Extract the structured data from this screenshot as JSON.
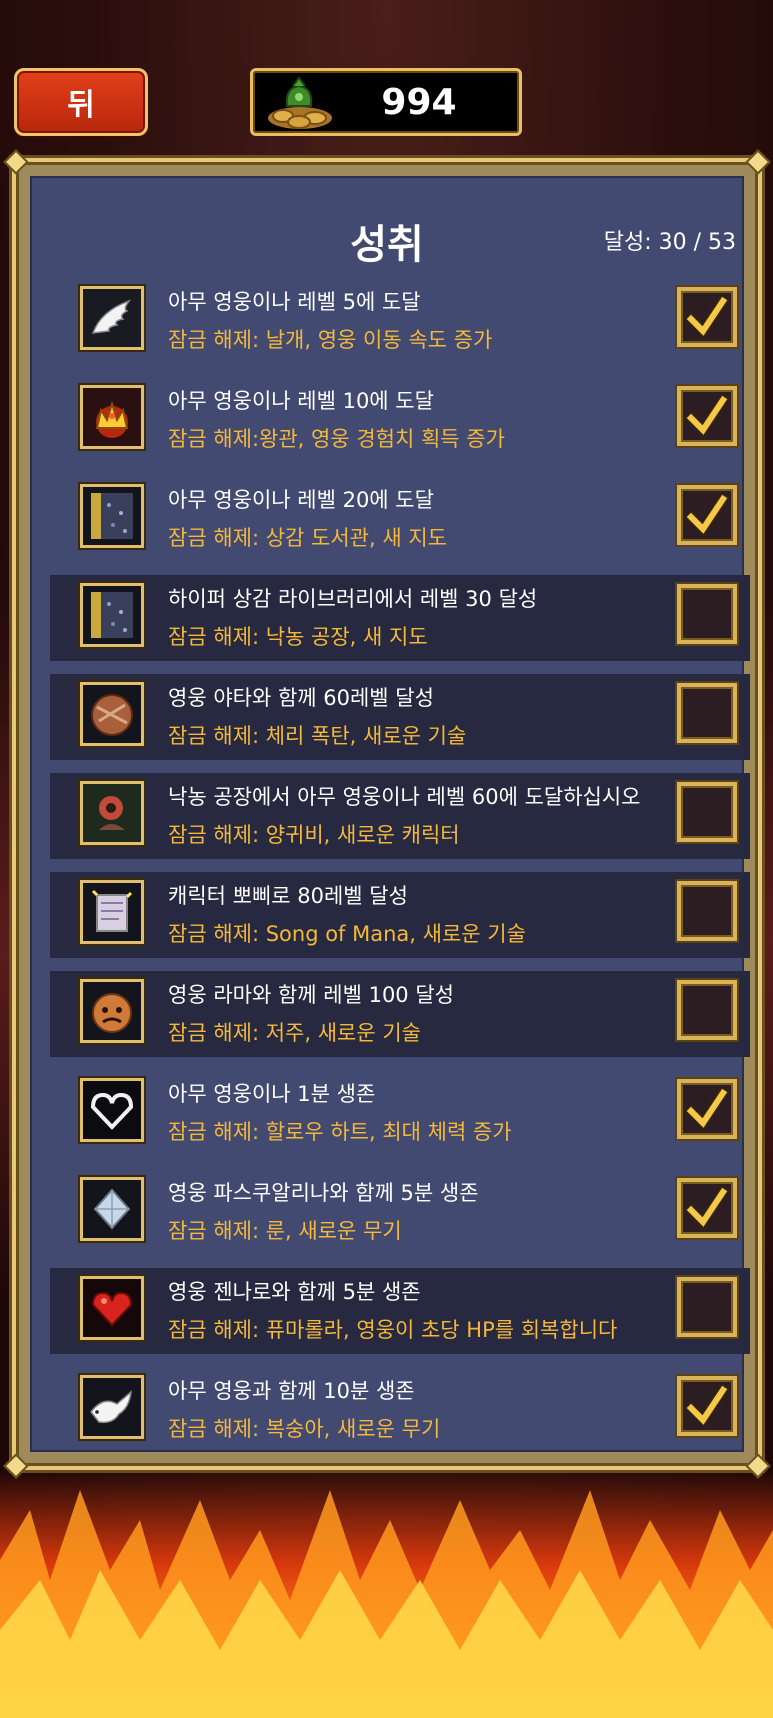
{
  "header": {
    "back_label": "뒤",
    "coins": "994"
  },
  "panel": {
    "title": "성취",
    "progress": "달성: 30 / 53"
  },
  "achievements": [
    {
      "desc": "아무 영웅이나 레벨 5에 도달",
      "reward": "잠금 해제: 날개, 영웅 이동 속도 증가",
      "completed": true,
      "icon": "wing-icon"
    },
    {
      "desc": "아무 영웅이나 레벨 10에 도달",
      "reward": "잠금 해제:왕관, 영웅 경험치 획득 증가",
      "completed": true,
      "icon": "crown-icon"
    },
    {
      "desc": "아무 영웅이나 레벨 20에 도달",
      "reward": "잠금 해제: 상감 도서관, 새 지도",
      "completed": true,
      "icon": "library-map-icon"
    },
    {
      "desc": "하이퍼 상감 라이브러리에서 레벨 30 달성",
      "reward": "잠금 해제: 낙농 공장, 새 지도",
      "completed": false,
      "icon": "library-map-icon"
    },
    {
      "desc": "영웅 야타와 함께 60레벨 달성",
      "reward": "잠금 해제: 체리 폭탄, 새로운 기술",
      "completed": false,
      "icon": "cherry-bomb-icon"
    },
    {
      "desc": "낙농 공장에서 아무 영웅이나 레벨 60에 도달하십시오",
      "reward": "잠금 해제: 양귀비, 새로운 캐릭터",
      "completed": false,
      "icon": "poppy-character-icon"
    },
    {
      "desc": "캐릭터 뽀삐로 80레벨 달성",
      "reward": "잠금 해제: Song of Mana, 새로운 기술",
      "completed": false,
      "icon": "scroll-icon"
    },
    {
      "desc": "영웅 라마와 함께 레벨 100 달성",
      "reward": "잠금 해제: 저주, 새로운 기술",
      "completed": false,
      "icon": "curse-icon"
    },
    {
      "desc": "아무 영웅이나 1분 생존",
      "reward": "잠금 해제: 할로우 하트, 최대 체력 증가",
      "completed": true,
      "icon": "hollow-heart-icon"
    },
    {
      "desc": "영웅 파스쿠알리나와 함께 5분 생존",
      "reward": "잠금 해제: 룬, 새로운 무기",
      "completed": true,
      "icon": "rune-icon"
    },
    {
      "desc": "영웅 젠나로와 함께 5분 생존",
      "reward": "잠금 해제: 퓨마롤라, 영웅이 초당 HP를 회복합니다",
      "completed": false,
      "icon": "heart-icon"
    },
    {
      "desc": "아무 영웅과 함께 10분 생존",
      "reward": "잠금 해제: 복숭아, 새로운 무기",
      "completed": true,
      "icon": "dove-icon"
    }
  ]
}
